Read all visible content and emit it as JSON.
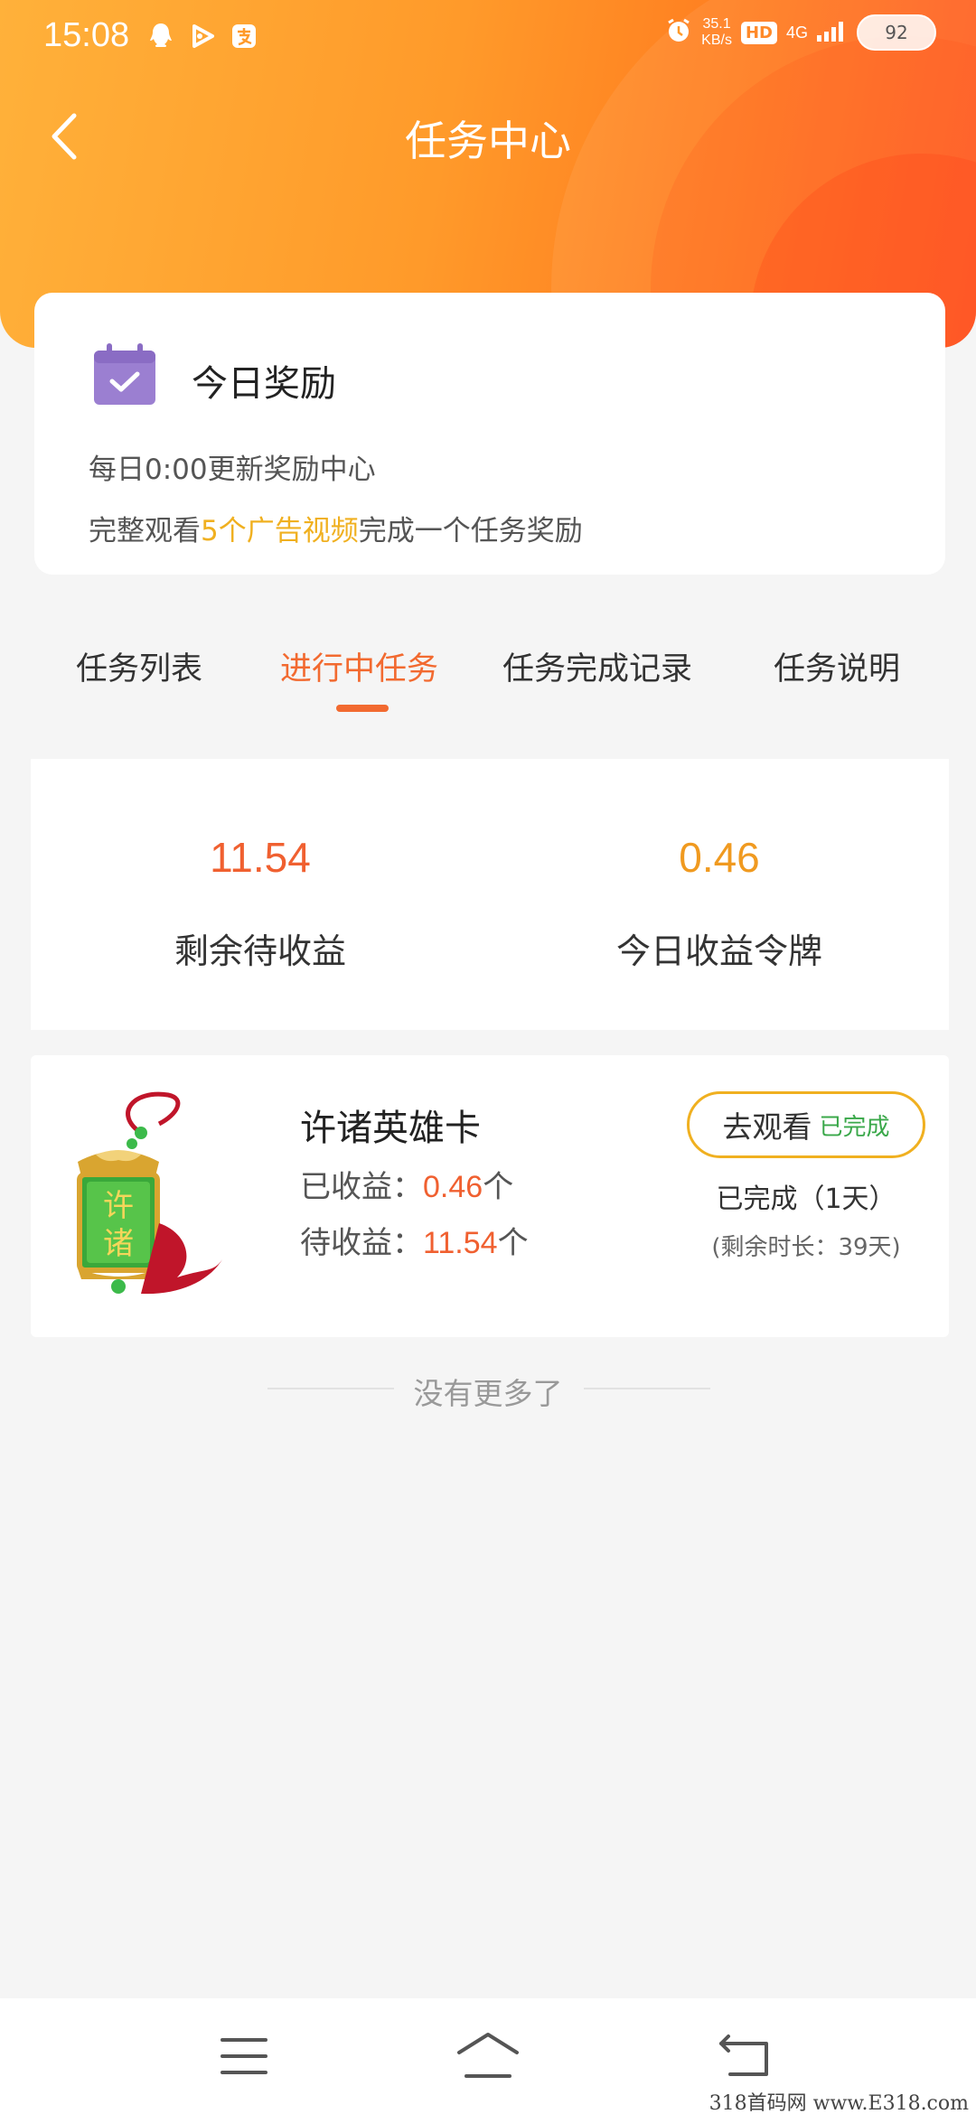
{
  "status_bar": {
    "time": "15:08",
    "net_speed_value": "35.1",
    "net_speed_unit": "KB/s",
    "hd": "HD",
    "network": "4G",
    "battery": "92",
    "icons": [
      "qq-icon",
      "play-icon",
      "alipay-icon",
      "alarm-icon",
      "signal-icon",
      "battery-icon"
    ]
  },
  "header": {
    "title": "任务中心",
    "gradient_colors": [
      "#ffb13a",
      "#ff7a1f",
      "#ff5a22"
    ]
  },
  "reward": {
    "title": "今日奖励",
    "line1": "每日0:00更新奖励中心",
    "line2_prefix": "完整观看",
    "line2_highlight": "5个广告视频",
    "line2_suffix": "完成一个任务奖励",
    "highlight_color": "#f0b020"
  },
  "tabs": [
    {
      "label": "任务列表",
      "active": false
    },
    {
      "label": "进行中任务",
      "active": true
    },
    {
      "label": "任务完成记录",
      "active": false
    },
    {
      "label": "任务说明",
      "active": false
    }
  ],
  "stats": {
    "pending": {
      "value": "11.54",
      "label": "剩余待收益",
      "color": "#f06030"
    },
    "today": {
      "value": "0.46",
      "label": "今日收益令牌",
      "color": "#f09a20"
    }
  },
  "task": {
    "name": "许诸英雄卡",
    "image_text": "许诸",
    "earned_label": "已收益：",
    "earned_value": "0.46",
    "earned_unit": "个",
    "pending_label": "待收益：",
    "pending_value": "11.54",
    "pending_unit": "个",
    "watch_label": "去观看",
    "watch_done": "已完成",
    "status": "已完成（1天）",
    "remaining": "(剩余时长：39天)"
  },
  "list_end": "没有更多了",
  "nav": {
    "buttons": [
      "menu-icon",
      "home-icon",
      "back-icon"
    ]
  },
  "watermark": "318首码网 www.E318.com"
}
